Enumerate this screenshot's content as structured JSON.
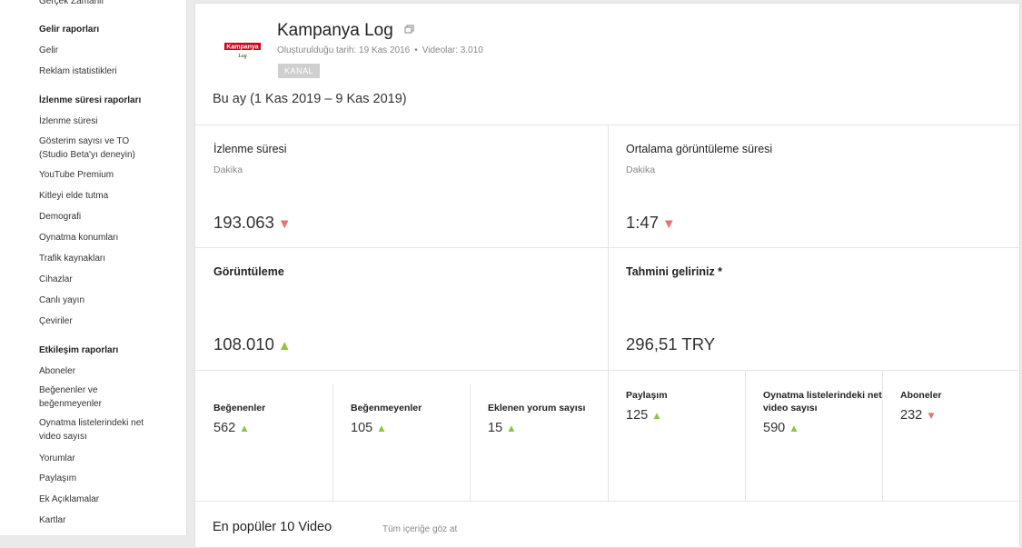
{
  "sidebar": {
    "top_item": "Gerçek Zamanlı",
    "sections": [
      {
        "heading": "Gelir raporları",
        "items": [
          "Gelir",
          "Reklam istatistikleri"
        ]
      },
      {
        "heading": "İzlenme süresi raporları",
        "items": [
          "İzlenme süresi",
          "Gösterim sayısı ve TO (Studio Beta'yı deneyin)",
          "YouTube Premium",
          "Kitleyi elde tutma",
          "Demografi",
          "Oynatma konumları",
          "Trafik kaynakları",
          "Cihazlar",
          "Canlı yayın",
          "Çeviriler"
        ]
      },
      {
        "heading": "Etkileşim raporları",
        "items": [
          "Aboneler",
          "Beğenenler ve beğenmeyenler",
          "Oynatma listelerindeki net video sayısı",
          "Yorumlar",
          "Paylaşım",
          "Ek Açıklamalar",
          "Kartlar"
        ]
      }
    ]
  },
  "channel": {
    "logo_text_top": "Kampanya",
    "logo_text_bottom": "Log",
    "title": "Kampanya Log",
    "created": "Oluşturulduğu tarih: 19 Kas 2016",
    "videos": "Videolar: 3.010",
    "badge": "KANAL"
  },
  "date_range": "Bu ay (1 Kas 2019 – 9 Kas 2019)",
  "metrics": {
    "watch_time": {
      "title": "İzlenme süresi",
      "unit": "Dakika",
      "value": "193.063",
      "trend": "▼"
    },
    "avg_view": {
      "title": "Ortalama görüntüleme süresi",
      "unit": "Dakika",
      "value": "1:47",
      "trend": "▼"
    },
    "views": {
      "title": "Görüntüleme",
      "value": "108.010",
      "trend": "▲"
    },
    "revenue": {
      "title": "Tahmini geliriniz *",
      "value": "296,51 TRY"
    }
  },
  "engagement": [
    {
      "title": "Beğenenler",
      "value": "562",
      "trend": "▲"
    },
    {
      "title": "Beğenmeyenler",
      "value": "105",
      "trend": "▲"
    },
    {
      "title": "Eklenen yorum sayısı",
      "value": "15",
      "trend": "▲"
    },
    {
      "title": "Paylaşım",
      "value": "125",
      "trend": "▲"
    },
    {
      "title": "Oynatma listelerindeki net video sayısı",
      "value": "590",
      "trend": "▲"
    },
    {
      "title": "Aboneler",
      "value": "232",
      "trend": "▼"
    }
  ],
  "popular": {
    "title": "En popüler 10 Video",
    "view_all": "Tüm içeriğe göz at"
  },
  "colors": {
    "up": "#8cc63f",
    "down": "#e57373",
    "logo_red": "#d0021b"
  }
}
